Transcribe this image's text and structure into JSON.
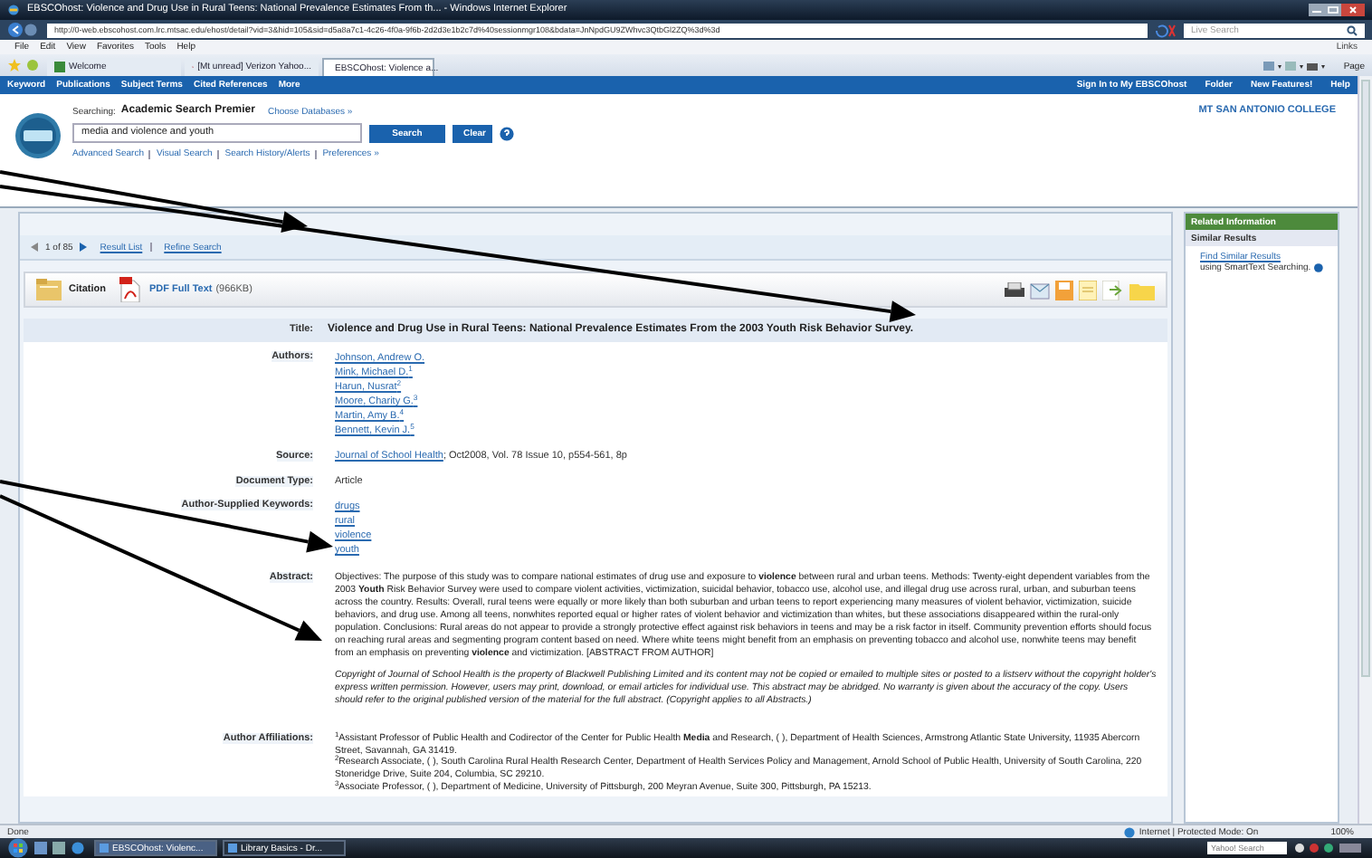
{
  "browser": {
    "title": "EBSCOhost: Violence and Drug Use in Rural Teens: National Prevalence Estimates From th... - Windows Internet Explorer",
    "address": "http://0-web.ebscohost.com.lrc.mtsac.edu/ehost/detail?vid=3&hid=105&sid=d5a8a7c1-4c26-4f0a-9f6b-2d2d3e1b2c7d%40sessionmgr108&bdata=JnNpdGU9ZWhvc3QtbGl2ZQ%3d%3d",
    "search_placeholder": "Live Search",
    "menu": [
      "File",
      "Edit",
      "View",
      "Favorites",
      "Tools",
      "Help"
    ],
    "links_label": "Links",
    "tabs": [
      {
        "label": "Welcome",
        "selected": false
      },
      {
        "label": "[Mt unread] Verizon Yahoo...",
        "selected": false
      },
      {
        "label": "EBSCOhost: Violence a...",
        "selected": true
      }
    ],
    "page_menu": "Page"
  },
  "ebsco_nav": {
    "left": [
      "Keyword",
      "Publications",
      "Subject Terms",
      "Cited References",
      "More"
    ],
    "right": [
      "Sign In to My EBSCOhost",
      "Folder",
      "New Features!",
      "Help"
    ]
  },
  "search": {
    "searching_label": "Searching:",
    "database": "Academic Search Premier",
    "choose": "Choose Databases »",
    "query": "media and violence and youth",
    "buttons": [
      "Search",
      "Clear"
    ],
    "links": [
      "Advanced Search",
      "Visual Search",
      "Search History/Alerts",
      "Preferences »"
    ]
  },
  "institution": "MT SAN ANTONIO COLLEGE",
  "result_nav": {
    "position": "1 of 85",
    "links": [
      "Result List",
      "Refine Search"
    ]
  },
  "formats": [
    {
      "kind": "citation",
      "label": "Citation"
    },
    {
      "kind": "pdf",
      "label": "PDF Full Text",
      "size": "(966KB)"
    }
  ],
  "record": {
    "title_label": "Title:",
    "title": "Violence and Drug Use in Rural Teens: National Prevalence Estimates From the 2003 Youth Risk Behavior Survey.",
    "fields": [
      {
        "kind": "links",
        "label": "Authors:",
        "items": [
          "Johnson, Andrew O.",
          "Mink, Michael D.$^{1}$",
          "Harun, Nusrat$^{2}$",
          "Moore, Charity G.$^{3}$",
          "Martin, Amy B.$^{4}$",
          "Bennett, Kevin J.$^{5}$"
        ]
      },
      {
        "kind": "source",
        "label": "Source:",
        "link": "Journal of School Health",
        "text": "; Oct2008, Vol. 78 Issue 10, p554-561, 8p"
      },
      {
        "kind": "text",
        "label": "Document Type:",
        "text": "Article"
      },
      {
        "kind": "links",
        "label": "Author-Supplied Keywords:",
        "items": [
          "drugs",
          "rural",
          "violence",
          "youth"
        ]
      },
      {
        "kind": "abstract",
        "label": "Abstract:",
        "paragraphs": [
          "Objectives: The purpose of this study was to compare national estimates of drug use and exposure to **violence** between rural and urban teens. Methods: Twenty-eight dependent variables from the 2003 **Youth** Risk Behavior Survey were used to compare violent activities, victimization, suicidal behavior, tobacco use, alcohol use, and illegal drug use across rural, urban, and suburban teens across the country. Results: Overall, rural teens were equally or more likely than both suburban and urban teens to report experiencing many measures of violent behavior, victimization, suicide behaviors, and drug use. Among all teens, nonwhites reported equal or higher rates of violent behavior and victimization than whites, but these associations disappeared within the rural-only population. Conclusions: Rural areas do not appear to provide a strongly protective effect against risk behaviors in teens and may be a risk factor in itself. Community prevention efforts should focus on reaching rural areas and segmenting program content based on need. Where white teens might benefit from an emphasis on preventing tobacco and alcohol use, nonwhite teens may benefit from an emphasis on preventing **violence** and victimization. [ABSTRACT FROM AUTHOR]"
        ],
        "copyright": "Copyright of Journal of School Health is the property of Blackwell Publishing Limited and its content may not be copied or emailed to multiple sites or posted to a listserv without the copyright holder's express written permission. However, users may print, download, or email articles for individual use. This abstract may be abridged. No warranty is given about the accuracy of the copy. Users should refer to the original published version of the material for the full abstract. (Copyright applies to all Abstracts.)"
      },
      {
        "kind": "affiliations",
        "label": "Author Affiliations:",
        "items": [
          "$^{1}$Assistant Professor of Public Health and Codirector of the Center for Public Health **Media** and Research, ( ), Department of Health Sciences, Armstrong Atlantic State University, 11935 Abercorn Street, Savannah, GA 31419.",
          "$^{2}$Research Associate, ( ), South Carolina Rural Health Research Center, Department of Health Services Policy and Management, Arnold School of Public Health, University of South Carolina, 220 Stoneridge Drive, Suite 204, Columbia, SC 29210.",
          "$^{3}$Associate Professor, ( ), Department of Medicine, University of Pittsburgh, 200 Meyran Avenue, Suite 300, Pittsburgh, PA 15213."
        ]
      }
    ]
  },
  "related": {
    "header": "Related Information",
    "section": "Similar Results",
    "link": "Find Similar Results",
    "text": "using SmartText Searching."
  },
  "status_bar": {
    "text": "Done",
    "zone": "Internet | Protected Mode: On",
    "zoom": "100%"
  },
  "taskbar": {
    "items": [
      {
        "label": "EBSCOhost: Violenc...",
        "selected": true
      },
      {
        "label": "Library Basics - Dr...",
        "selected": false
      }
    ],
    "search_placeholder": "Yahoo! Search"
  }
}
